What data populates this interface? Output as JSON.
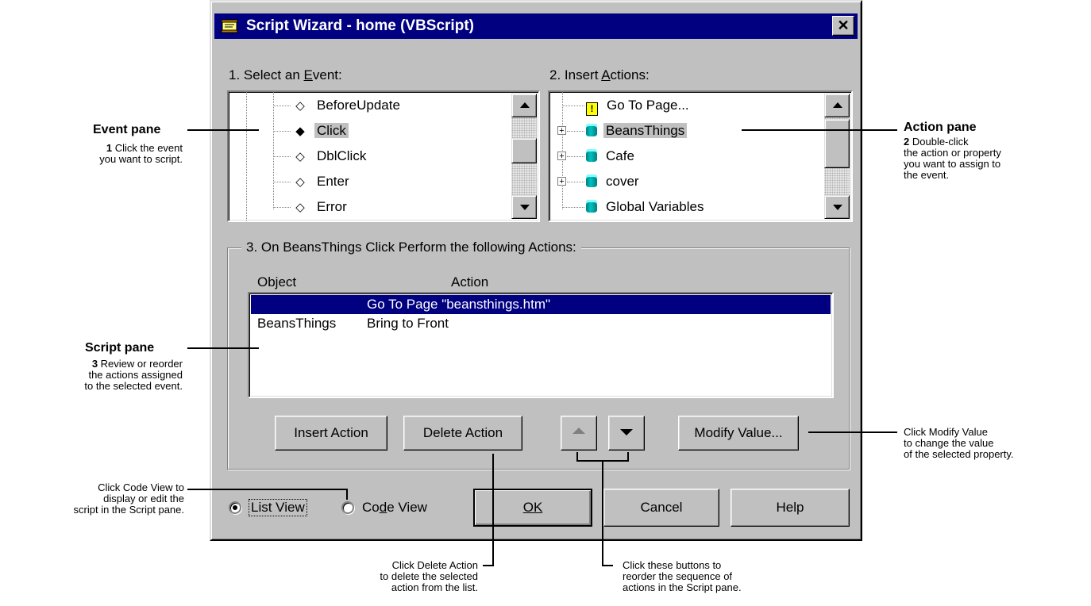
{
  "dialog": {
    "title": "Script Wizard - home (VBScript)",
    "close_glyph": "✕",
    "event_label_pre": "1. Select an ",
    "event_label_key": "E",
    "event_label_post": "vent:",
    "action_label_pre": "2. Insert ",
    "action_label_key": "A",
    "action_label_post": "ctions:",
    "events": [
      "BeforeUpdate",
      "Click",
      "DblClick",
      "Enter",
      "Error"
    ],
    "selected_event": "Click",
    "actions": [
      {
        "label": "Go To Page...",
        "icon": "page-warning-icon",
        "expandable": false
      },
      {
        "label": "BeansThings",
        "icon": "database-icon",
        "expandable": true
      },
      {
        "label": "Cafe",
        "icon": "database-icon",
        "expandable": true
      },
      {
        "label": "cover",
        "icon": "database-icon",
        "expandable": true
      },
      {
        "label": "Global Variables",
        "icon": "database-icon",
        "expandable": false
      }
    ],
    "selected_action": "BeansThings",
    "group_label": "3. On BeansThings Click Perform the following Actions:",
    "script_columns": {
      "object": "Object",
      "action": "Action"
    },
    "script_rows": [
      {
        "object": "",
        "action": "Go To Page \"beansthings.htm\"",
        "selected": true
      },
      {
        "object": "BeansThings",
        "action": "Bring to Front",
        "selected": false
      }
    ],
    "buttons": {
      "insert_action": "Insert Action",
      "delete_action": "Delete Action",
      "modify_value": "Modify Value...",
      "ok": "OK",
      "cancel": "Cancel",
      "help": "Help"
    },
    "views": {
      "list_view": "List View",
      "code_view_pre": "Co",
      "code_view_key": "d",
      "code_view_post": "e View",
      "selected": "list_view"
    }
  },
  "callouts": {
    "event_pane": {
      "title": "Event pane",
      "step": "1",
      "text": "Click the event\nyou want to script."
    },
    "action_pane": {
      "title": "Action pane",
      "step": "2",
      "text": "Double-click\nthe action or property\nyou want to assign to\nthe event."
    },
    "script_pane": {
      "title": "Script pane",
      "step": "3",
      "text": "Review or reorder\nthe actions assigned\nto the selected event."
    },
    "code_view": {
      "text": "Click Code View to\ndisplay or edit the\nscript in the Script pane."
    },
    "modify_value": {
      "text": "Click Modify Value\nto change the value\nof the selected property."
    },
    "delete_action": {
      "text": "Click Delete Action\nto delete the selected\naction from the list."
    },
    "reorder": {
      "text": "Click these buttons to\nreorder the sequence of\nactions in the Script pane."
    }
  },
  "colors": {
    "titlebar": "#000080",
    "face": "#c0c0c0",
    "selection": "#000080"
  }
}
